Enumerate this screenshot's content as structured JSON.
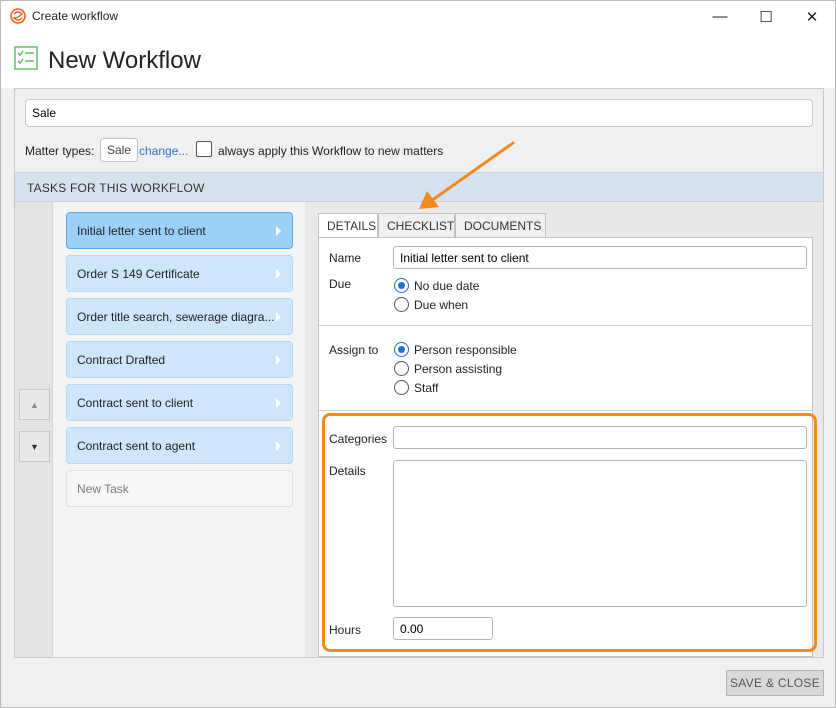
{
  "window": {
    "title": "Create workflow",
    "controls": {
      "minimize": "—",
      "maximize": "☐",
      "close": "✕"
    }
  },
  "header": {
    "title": "New Workflow"
  },
  "workflow": {
    "name_value": "Sale",
    "matter_types_label": "Matter types:",
    "matter_type_chip": "Sale",
    "change_link": "change...",
    "always_apply_label": "always apply this Workflow to new matters",
    "always_apply_checked": false
  },
  "tasks_section": {
    "title": "TASKS FOR THIS WORKFLOW",
    "tasks": [
      {
        "label": "Initial letter sent to client",
        "active": true
      },
      {
        "label": "Order S 149 Certificate",
        "active": false
      },
      {
        "label": "Order title search, sewerage diagra...",
        "active": false
      },
      {
        "label": "Contract Drafted",
        "active": false
      },
      {
        "label": "Contract sent to client",
        "active": false
      },
      {
        "label": "Contract sent to agent",
        "active": false
      }
    ],
    "new_task_label": "New Task",
    "move_up_icon": "▲",
    "move_down_icon": "▼"
  },
  "tabs": [
    {
      "label": "DETAILS",
      "active": true
    },
    {
      "label": "CHECKLIST",
      "active": false
    },
    {
      "label": "DOCUMENTS",
      "active": false
    }
  ],
  "details": {
    "name_label": "Name",
    "name_value": "Initial letter sent to client",
    "due_label": "Due",
    "due_options": [
      {
        "label": "No due date",
        "selected": true
      },
      {
        "label": "Due when",
        "selected": false
      }
    ],
    "assign_label": "Assign to",
    "assign_options": [
      {
        "label": "Person responsible",
        "selected": true
      },
      {
        "label": "Person assisting",
        "selected": false
      },
      {
        "label": "Staff",
        "selected": false
      }
    ],
    "categories_label": "Categories",
    "categories_value": "",
    "details_label": "Details",
    "details_value": "",
    "hours_label": "Hours",
    "hours_value": "0.00"
  },
  "footer": {
    "save_close_label": "SAVE & CLOSE"
  },
  "colors": {
    "accent_orange": "#f28a1e",
    "task_active": "#9dd0f7",
    "task_default": "#cde6fb",
    "section_bar": "#d5e1ec",
    "link": "#2e74c9"
  }
}
